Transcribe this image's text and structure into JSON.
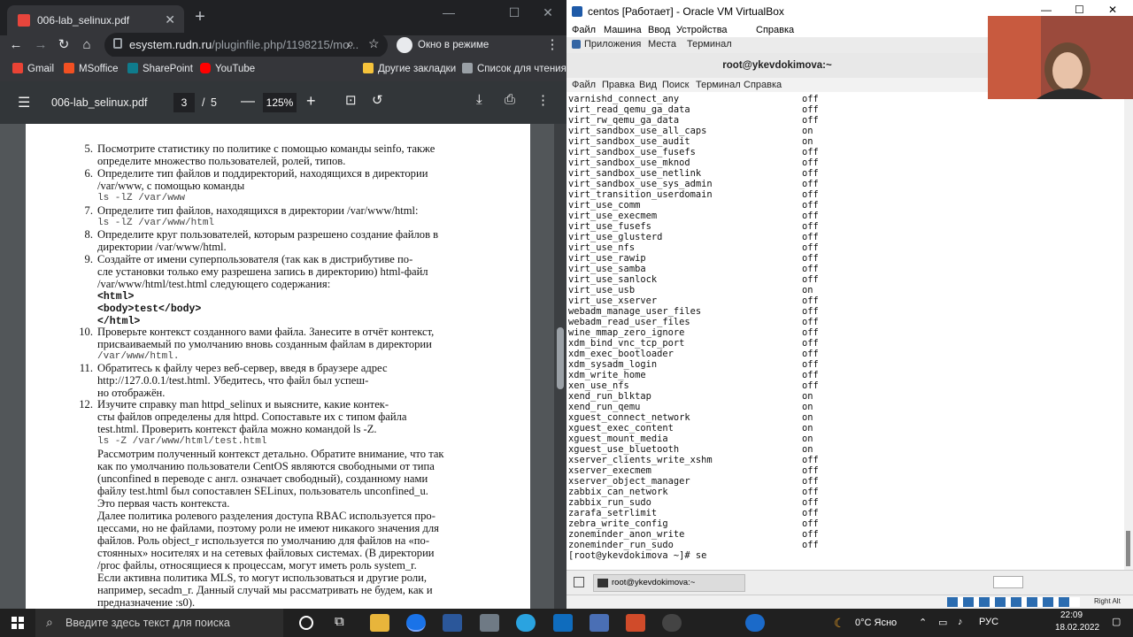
{
  "chrome": {
    "tab_title": "006-lab_selinux.pdf",
    "url_host": "esystem.rudn.ru",
    "url_path": "/pluginfile.php/1198215/mo...",
    "incognito_label": "Окно в режиме инкогнито",
    "bookmarks": [
      "Gmail",
      "MSoffice",
      "SharePoint",
      "YouTube"
    ],
    "bookmarks_right": [
      "Другие закладки",
      "Список для чтения"
    ],
    "pdf": {
      "filename": "006-lab_selinux.pdf",
      "page_current": "3",
      "page_sep": "/",
      "page_total": "5",
      "zoom": "125%"
    }
  },
  "document": {
    "items": [
      {
        "num": "5.",
        "lines": [
          "Посмотрите статистику по политике с помощью команды seinfo, также",
          "определите множество пользователей, ролей, типов."
        ]
      },
      {
        "num": "6.",
        "lines": [
          "Определите тип файлов и поддиректорий, находящихся в директории",
          "/var/www, с помощью команды",
          "ls -lZ /var/www"
        ]
      },
      {
        "num": "7.",
        "lines": [
          "Определите тип файлов, находящихся в директории /var/www/html:",
          "ls -lZ /var/www/html"
        ]
      },
      {
        "num": "8.",
        "lines": [
          "Определите круг пользователей, которым разрешено создание файлов в",
          "директории /var/www/html."
        ]
      },
      {
        "num": "9.",
        "lines": [
          "Создайте от имени суперпользователя (так как в дистрибутиве по-",
          "сле установки только ему разрешена запись в директорию) html-файл",
          "/var/www/html/test.html следующего содержания:"
        ]
      },
      {
        "num": "10.",
        "lines": [
          "Проверьте контекст созданного вами файла. Занесите в отчёт контекст,",
          "присваиваемый по умолчанию вновь созданным файлам в директории",
          "/var/www/html."
        ]
      },
      {
        "num": "11.",
        "lines": [
          "Обратитесь к файлу через веб-сервер, введя в браузере адрес",
          "http://127.0.0.1/test.html. Убедитесь, что файл был успеш-",
          "но отображён."
        ]
      },
      {
        "num": "12.",
        "lines": [
          "Изучите справку man httpd_selinux и выясните, какие контек-",
          "сты файлов определены для httpd. Сопоставьте их с типом файла",
          "test.html. Проверить контекст файла можно командой ls -Z.",
          "ls -Z /var/www/html/test.html",
          "Рассмотрим полученный контекст детально. Обратите внимание, что так",
          "как по умолчанию пользователи CentOS являются свободными от типа",
          "(unconfined в переводе с англ. означает свободный), созданному нами",
          "файлу test.html был сопоставлен SELinux, пользователь unconfined_u.",
          "Это первая часть контекста.",
          "Далее политика ролевого разделения доступа RBAC используется про-",
          "цессами, но не файлами, поэтому роли не имеют никакого значения для",
          "файлов. Роль object_r используется по умолчанию для файлов на «по-",
          "стоянных» носителях и на сетевых файловых системах. (В директории",
          "/proc файлы, относящиеся к процессам, могут иметь роль system_r.",
          "Если активна политика MLS, то могут использоваться и другие роли,",
          "например, secadm_r. Данный случай мы рассматривать не будем, как и",
          "предназначение :s0)."
        ]
      }
    ],
    "html_code": [
      "<html>",
      "<body>test</body>",
      "</html>"
    ]
  },
  "vbox": {
    "title": "centos [Работает] - Oracle VM VirtualBox",
    "menu": [
      "Файл",
      "Машина",
      "Ввод",
      "Устройства",
      "Справка"
    ],
    "gnome_menu": [
      "Приложения",
      "Места",
      "Терминал"
    ],
    "terminal_title": "root@ykevdokimova:~",
    "terminal_menu": [
      "Файл",
      "Правка",
      "Вид",
      "Поиск",
      "Терминал",
      "Справка"
    ],
    "booleans": [
      [
        "varnishd_connect_any",
        "off"
      ],
      [
        "virt_read_qemu_ga_data",
        "off"
      ],
      [
        "virt_rw_qemu_ga_data",
        "off"
      ],
      [
        "virt_sandbox_use_all_caps",
        "on"
      ],
      [
        "virt_sandbox_use_audit",
        "on"
      ],
      [
        "virt_sandbox_use_fusefs",
        "off"
      ],
      [
        "virt_sandbox_use_mknod",
        "off"
      ],
      [
        "virt_sandbox_use_netlink",
        "off"
      ],
      [
        "virt_sandbox_use_sys_admin",
        "off"
      ],
      [
        "virt_transition_userdomain",
        "off"
      ],
      [
        "virt_use_comm",
        "off"
      ],
      [
        "virt_use_execmem",
        "off"
      ],
      [
        "virt_use_fusefs",
        "off"
      ],
      [
        "virt_use_glusterd",
        "off"
      ],
      [
        "virt_use_nfs",
        "off"
      ],
      [
        "virt_use_rawip",
        "off"
      ],
      [
        "virt_use_samba",
        "off"
      ],
      [
        "virt_use_sanlock",
        "off"
      ],
      [
        "virt_use_usb",
        "on"
      ],
      [
        "virt_use_xserver",
        "off"
      ],
      [
        "webadm_manage_user_files",
        "off"
      ],
      [
        "webadm_read_user_files",
        "off"
      ],
      [
        "wine_mmap_zero_ignore",
        "off"
      ],
      [
        "xdm_bind_vnc_tcp_port",
        "off"
      ],
      [
        "xdm_exec_bootloader",
        "off"
      ],
      [
        "xdm_sysadm_login",
        "off"
      ],
      [
        "xdm_write_home",
        "off"
      ],
      [
        "xen_use_nfs",
        "off"
      ],
      [
        "xend_run_blktap",
        "on"
      ],
      [
        "xend_run_qemu",
        "on"
      ],
      [
        "xguest_connect_network",
        "on"
      ],
      [
        "xguest_exec_content",
        "on"
      ],
      [
        "xguest_mount_media",
        "on"
      ],
      [
        "xguest_use_bluetooth",
        "on"
      ],
      [
        "xserver_clients_write_xshm",
        "off"
      ],
      [
        "xserver_execmem",
        "off"
      ],
      [
        "xserver_object_manager",
        "off"
      ],
      [
        "zabbix_can_network",
        "off"
      ],
      [
        "zabbix_run_sudo",
        "off"
      ],
      [
        "zarafa_setrlimit",
        "off"
      ],
      [
        "zebra_write_config",
        "off"
      ],
      [
        "zoneminder_anon_write",
        "off"
      ],
      [
        "zoneminder_run_sudo",
        "off"
      ]
    ],
    "prompt": "[root@ykevdokimova ~]# se",
    "task_item": "root@ykevdokimova:~",
    "host_key": "Right Alt"
  },
  "taskbar": {
    "search_placeholder": "Введите здесь текст для поиска",
    "weather": "0°C Ясно",
    "lang": "РУС",
    "time": "22:09",
    "date": "18.02.2022"
  }
}
